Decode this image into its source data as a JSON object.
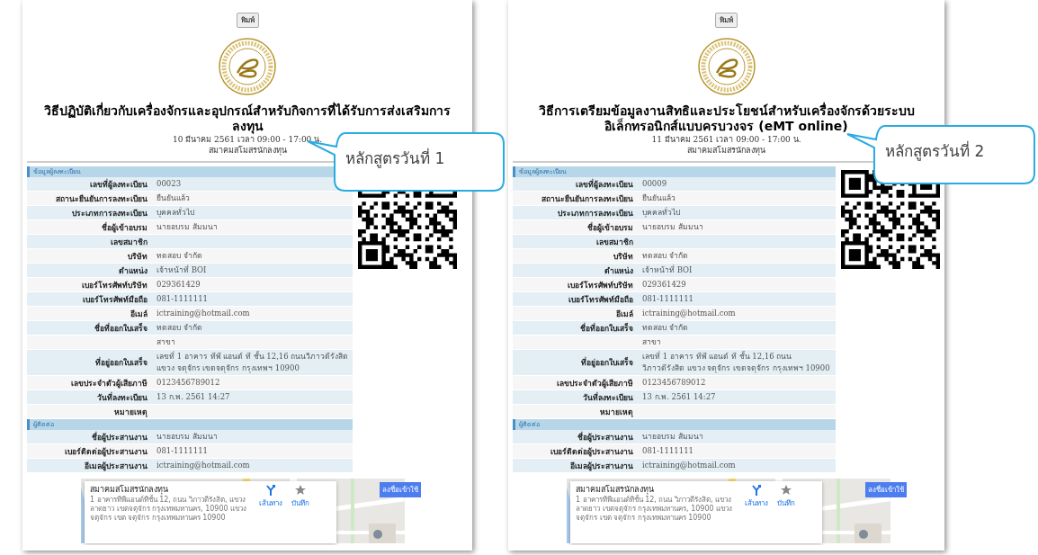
{
  "panels": [
    {
      "print_button": "พิมพ์",
      "title": "วิธีปฏิบัติเกี่ยวกับเครื่องจักรและอุปกรณ์สำหรับกิจการที่ได้รับการส่งเสริมการลงทุน",
      "date": "10 มีนาคม 2561 เวลา 09:00 - 17:00 น.",
      "venue": "สมาคมสโมสรนักลงทุน",
      "callout": "หลักสูตรวันที่ 1",
      "sections": [
        {
          "heading": "ข้อมูลผู้ลงทะเบียน",
          "rows": [
            {
              "label": "เลขที่ผู้ลงทะเบียน",
              "value": "00023"
            },
            {
              "label": "สถานะยืนยันการลงทะเบียน",
              "value": "ยืนยันแล้ว"
            },
            {
              "label": "ประเภทการลงทะเบียน",
              "value": "บุคคลทั่วไป"
            },
            {
              "label": "ชื่อผู้เข้าอบรม",
              "value": "นายอบรม สัมมนา"
            },
            {
              "label": "เลขสมาชิก"
            },
            {
              "label": "บริษัท",
              "value": "ทดสอบ จำกัด"
            },
            {
              "label": "ตำแหน่ง",
              "value": "เจ้าหน้าที่ BOI"
            },
            {
              "label": "เบอร์โทรศัพท์บริษัท",
              "value": "029361429"
            },
            {
              "label": "เบอร์โทรศัพท์มือถือ",
              "value": "081-1111111"
            },
            {
              "label": "อีเมล์",
              "value": "ictraining@hotmail.com"
            },
            {
              "label": "ชื่อที่ออกใบเสร็จ",
              "value": "ทดสอบ จำกัด"
            },
            {
              "value": "สาขา"
            },
            {
              "label": "ที่อยู่ออกใบเสร็จ",
              "value": "เลขที่ 1 อาคาร ทีพี แอนด์ ที ชั้น 12,16 ถนนวิภาวดีรังสิต แขวง จตุจักร เขตจตุจักร กรุงเทพฯ 10900"
            },
            {
              "label": "เลขประจำตัวผู้เสียภาษี",
              "value": "0123456789012"
            },
            {
              "label": "วันที่ลงทะเบียน",
              "value": "13 ก.พ. 2561 14:27"
            },
            {
              "label": "หมายเหตุ"
            }
          ]
        },
        {
          "heading": "ผู้ติดต่อ",
          "rows": [
            {
              "label": "ชื่อผู้ประสานงาน",
              "value": "นายอบรม สัมมนา"
            },
            {
              "label": "เบอร์ติดต่อผู้ประสานงาน",
              "value": "081-1111111"
            },
            {
              "label": "อีเมลผู้ประสานงาน",
              "value": "ictraining@hotmail.com"
            }
          ]
        }
      ],
      "map": {
        "kind": "picture",
        "place_name": "สมาคมสโมสรนักลงทุน",
        "address": "1 อาคารทีพีแอนด์ทีชั้น 12, ถนน วิภาวดีรังสิต, แขวงลาดยาว เขตจตุจักร กรุงเทพมหานคร, 10900 แขวง จตุจักร เขต จตุจักร กรุงเทพมหานคร 10900",
        "directions": "เส้นทาง",
        "save": "บันทึก",
        "sign_in": "ลงชื่อเข้าใช้"
      }
    },
    {
      "print_button": "พิมพ์",
      "title": "วิธีการเตรียมข้อมูลงานสิทธิและประโยชน์สำหรับเครื่องจักรด้วยระบบอิเล็กทรอนิกส์แบบครบวงจร (eMT online)",
      "date": "11 มีนาคม 2561 เวลา 09:00 - 17:00 น.",
      "venue": "สมาคมสโมสรนักลงทุน",
      "callout": "หลักสูตรวันที่ 2",
      "sections": [
        {
          "heading": "ข้อมูลผู้ลงทะเบียน",
          "rows": [
            {
              "label": "เลขที่ผู้ลงทะเบียน",
              "value": "00009"
            },
            {
              "label": "สถานะยืนยันการลงทะเบียน",
              "value": "ยืนยันแล้ว"
            },
            {
              "label": "ประเภทการลงทะเบียน",
              "value": "บุคคลทั่วไป"
            },
            {
              "label": "ชื่อผู้เข้าอบรม",
              "value": "นายอบรม สัมมนา"
            },
            {
              "label": "เลขสมาชิก"
            },
            {
              "label": "บริษัท",
              "value": "ทดสอบ จำกัด"
            },
            {
              "label": "ตำแหน่ง",
              "value": "เจ้าหน้าที่ BOI"
            },
            {
              "label": "เบอร์โทรศัพท์บริษัท",
              "value": "029361429"
            },
            {
              "label": "เบอร์โทรศัพท์มือถือ",
              "value": "081-1111111"
            },
            {
              "label": "อีเมล์",
              "value": "ictraining@hotmail.com"
            },
            {
              "label": "ชื่อที่ออกใบเสร็จ",
              "value": "ทดสอบ จำกัด"
            },
            {
              "value": "สาขา"
            },
            {
              "label": "ที่อยู่ออกใบเสร็จ",
              "value": "เลขที่ 1 อาคาร ทีพี แอนด์ ที ชั้น 12,16 ถนนวิภาวดีรังสิต แขวง จตุจักร เขตจตุจักร กรุงเทพฯ 10900"
            },
            {
              "label": "เลขประจำตัวผู้เสียภาษี",
              "value": "0123456789012"
            },
            {
              "label": "วันที่ลงทะเบียน",
              "value": "13 ก.พ. 2561 14:27"
            },
            {
              "label": "หมายเหตุ"
            }
          ]
        },
        {
          "heading": "ผู้ติดต่อ",
          "rows": [
            {
              "label": "ชื่อผู้ประสานงาน",
              "value": "นายอบรม สัมมนา"
            },
            {
              "label": "เบอร์ติดต่อผู้ประสานงาน",
              "value": "081-1111111"
            },
            {
              "label": "อีเมลผู้ประสานงาน",
              "value": "ictraining@hotmail.com"
            }
          ]
        }
      ],
      "map": {
        "kind": "picture",
        "place_name": "สมาคมสโมสรนักลงทุน",
        "address": "1 อาคารทีพีแอนด์ทีชั้น 12, ถนน วิภาวดีรังสิต, แขวงลาดยาว เขตจตุจักร กรุงเทพมหานคร, 10900 แขวง จตุจักร เขต จตุจักร กรุงเทพมหานคร 10900",
        "directions": "เส้นทาง",
        "save": "บันทึก",
        "sign_in": "ลงชื่อเข้าใช้"
      }
    }
  ]
}
